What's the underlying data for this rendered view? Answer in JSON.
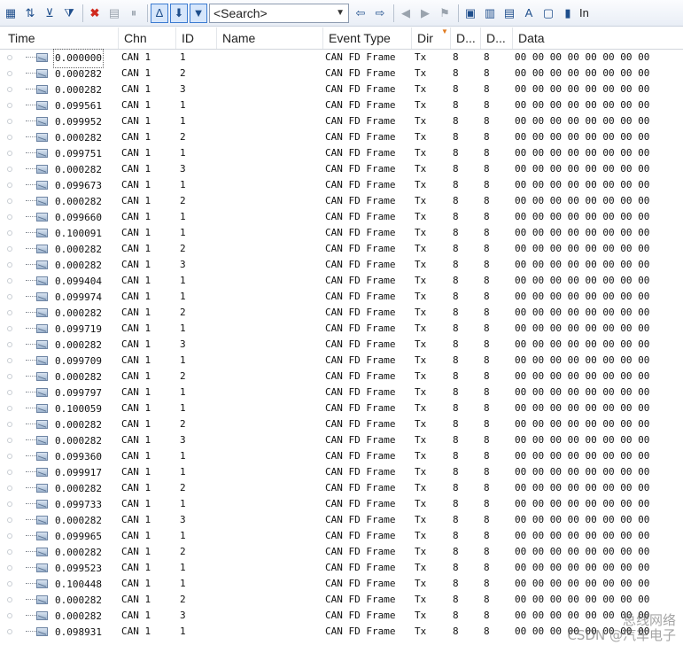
{
  "toolbar": {
    "search_placeholder": "<Search>",
    "cut_label": "In",
    "buttons": [
      "columns-icon",
      "sort-time-icon",
      "filter-icon",
      "filter-advanced-icon",
      "delete-icon",
      "clear-icon",
      "pause-icon",
      "time-mode-icon",
      "scroll-lock-icon",
      "display-filter-icon"
    ]
  },
  "columns": [
    "Time",
    "Chn",
    "ID",
    "Name",
    "Event Type",
    "Dir",
    "D...",
    "D...",
    "Data"
  ],
  "rows": [
    [
      "0.000000",
      "CAN 1",
      "1",
      "",
      "CAN FD Frame",
      "Tx",
      "8",
      "8",
      "00 00 00 00 00 00 00 00"
    ],
    [
      "0.000282",
      "CAN 1",
      "2",
      "",
      "CAN FD Frame",
      "Tx",
      "8",
      "8",
      "00 00 00 00 00 00 00 00"
    ],
    [
      "0.000282",
      "CAN 1",
      "3",
      "",
      "CAN FD Frame",
      "Tx",
      "8",
      "8",
      "00 00 00 00 00 00 00 00"
    ],
    [
      "0.099561",
      "CAN 1",
      "1",
      "",
      "CAN FD Frame",
      "Tx",
      "8",
      "8",
      "00 00 00 00 00 00 00 00"
    ],
    [
      "0.099952",
      "CAN 1",
      "1",
      "",
      "CAN FD Frame",
      "Tx",
      "8",
      "8",
      "00 00 00 00 00 00 00 00"
    ],
    [
      "0.000282",
      "CAN 1",
      "2",
      "",
      "CAN FD Frame",
      "Tx",
      "8",
      "8",
      "00 00 00 00 00 00 00 00"
    ],
    [
      "0.099751",
      "CAN 1",
      "1",
      "",
      "CAN FD Frame",
      "Tx",
      "8",
      "8",
      "00 00 00 00 00 00 00 00"
    ],
    [
      "0.000282",
      "CAN 1",
      "3",
      "",
      "CAN FD Frame",
      "Tx",
      "8",
      "8",
      "00 00 00 00 00 00 00 00"
    ],
    [
      "0.099673",
      "CAN 1",
      "1",
      "",
      "CAN FD Frame",
      "Tx",
      "8",
      "8",
      "00 00 00 00 00 00 00 00"
    ],
    [
      "0.000282",
      "CAN 1",
      "2",
      "",
      "CAN FD Frame",
      "Tx",
      "8",
      "8",
      "00 00 00 00 00 00 00 00"
    ],
    [
      "0.099660",
      "CAN 1",
      "1",
      "",
      "CAN FD Frame",
      "Tx",
      "8",
      "8",
      "00 00 00 00 00 00 00 00"
    ],
    [
      "0.100091",
      "CAN 1",
      "1",
      "",
      "CAN FD Frame",
      "Tx",
      "8",
      "8",
      "00 00 00 00 00 00 00 00"
    ],
    [
      "0.000282",
      "CAN 1",
      "2",
      "",
      "CAN FD Frame",
      "Tx",
      "8",
      "8",
      "00 00 00 00 00 00 00 00"
    ],
    [
      "0.000282",
      "CAN 1",
      "3",
      "",
      "CAN FD Frame",
      "Tx",
      "8",
      "8",
      "00 00 00 00 00 00 00 00"
    ],
    [
      "0.099404",
      "CAN 1",
      "1",
      "",
      "CAN FD Frame",
      "Tx",
      "8",
      "8",
      "00 00 00 00 00 00 00 00"
    ],
    [
      "0.099974",
      "CAN 1",
      "1",
      "",
      "CAN FD Frame",
      "Tx",
      "8",
      "8",
      "00 00 00 00 00 00 00 00"
    ],
    [
      "0.000282",
      "CAN 1",
      "2",
      "",
      "CAN FD Frame",
      "Tx",
      "8",
      "8",
      "00 00 00 00 00 00 00 00"
    ],
    [
      "0.099719",
      "CAN 1",
      "1",
      "",
      "CAN FD Frame",
      "Tx",
      "8",
      "8",
      "00 00 00 00 00 00 00 00"
    ],
    [
      "0.000282",
      "CAN 1",
      "3",
      "",
      "CAN FD Frame",
      "Tx",
      "8",
      "8",
      "00 00 00 00 00 00 00 00"
    ],
    [
      "0.099709",
      "CAN 1",
      "1",
      "",
      "CAN FD Frame",
      "Tx",
      "8",
      "8",
      "00 00 00 00 00 00 00 00"
    ],
    [
      "0.000282",
      "CAN 1",
      "2",
      "",
      "CAN FD Frame",
      "Tx",
      "8",
      "8",
      "00 00 00 00 00 00 00 00"
    ],
    [
      "0.099797",
      "CAN 1",
      "1",
      "",
      "CAN FD Frame",
      "Tx",
      "8",
      "8",
      "00 00 00 00 00 00 00 00"
    ],
    [
      "0.100059",
      "CAN 1",
      "1",
      "",
      "CAN FD Frame",
      "Tx",
      "8",
      "8",
      "00 00 00 00 00 00 00 00"
    ],
    [
      "0.000282",
      "CAN 1",
      "2",
      "",
      "CAN FD Frame",
      "Tx",
      "8",
      "8",
      "00 00 00 00 00 00 00 00"
    ],
    [
      "0.000282",
      "CAN 1",
      "3",
      "",
      "CAN FD Frame",
      "Tx",
      "8",
      "8",
      "00 00 00 00 00 00 00 00"
    ],
    [
      "0.099360",
      "CAN 1",
      "1",
      "",
      "CAN FD Frame",
      "Tx",
      "8",
      "8",
      "00 00 00 00 00 00 00 00"
    ],
    [
      "0.099917",
      "CAN 1",
      "1",
      "",
      "CAN FD Frame",
      "Tx",
      "8",
      "8",
      "00 00 00 00 00 00 00 00"
    ],
    [
      "0.000282",
      "CAN 1",
      "2",
      "",
      "CAN FD Frame",
      "Tx",
      "8",
      "8",
      "00 00 00 00 00 00 00 00"
    ],
    [
      "0.099733",
      "CAN 1",
      "1",
      "",
      "CAN FD Frame",
      "Tx",
      "8",
      "8",
      "00 00 00 00 00 00 00 00"
    ],
    [
      "0.000282",
      "CAN 1",
      "3",
      "",
      "CAN FD Frame",
      "Tx",
      "8",
      "8",
      "00 00 00 00 00 00 00 00"
    ],
    [
      "0.099965",
      "CAN 1",
      "1",
      "",
      "CAN FD Frame",
      "Tx",
      "8",
      "8",
      "00 00 00 00 00 00 00 00"
    ],
    [
      "0.000282",
      "CAN 1",
      "2",
      "",
      "CAN FD Frame",
      "Tx",
      "8",
      "8",
      "00 00 00 00 00 00 00 00"
    ],
    [
      "0.099523",
      "CAN 1",
      "1",
      "",
      "CAN FD Frame",
      "Tx",
      "8",
      "8",
      "00 00 00 00 00 00 00 00"
    ],
    [
      "0.100448",
      "CAN 1",
      "1",
      "",
      "CAN FD Frame",
      "Tx",
      "8",
      "8",
      "00 00 00 00 00 00 00 00"
    ],
    [
      "0.000282",
      "CAN 1",
      "2",
      "",
      "CAN FD Frame",
      "Tx",
      "8",
      "8",
      "00 00 00 00 00 00 00 00"
    ],
    [
      "0.000282",
      "CAN 1",
      "3",
      "",
      "CAN FD Frame",
      "Tx",
      "8",
      "8",
      "00 00 00 00 00 00 00 00"
    ],
    [
      "0.098931",
      "CAN 1",
      "1",
      "",
      "CAN FD Frame",
      "Tx",
      "8",
      "8",
      "00 00 00 00 00 00 00 00"
    ]
  ],
  "watermark": {
    "line1": "总线网络",
    "line2": "CSDN @汽车电子"
  }
}
